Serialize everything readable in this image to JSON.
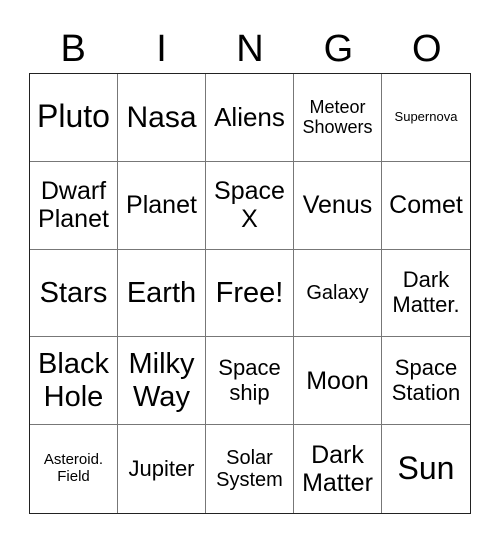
{
  "header": {
    "letters": [
      "B",
      "I",
      "N",
      "G",
      "O"
    ]
  },
  "cells": [
    "Pluto",
    "Nasa",
    "Aliens",
    "Meteor\nShowers",
    "Supernova",
    "Dwarf\nPlanet",
    "Planet",
    "Space\nX",
    "Venus",
    "Comet",
    "Stars",
    "Earth",
    "Free!",
    "Galaxy",
    "Dark\nMatter.",
    "Black\nHole",
    "Milky\nWay",
    "Space\nship",
    "Moon",
    "Space\nStation",
    "Asteroid.\nField",
    "Jupiter",
    "Solar\nSystem",
    "Dark\nMatter",
    "Sun"
  ]
}
